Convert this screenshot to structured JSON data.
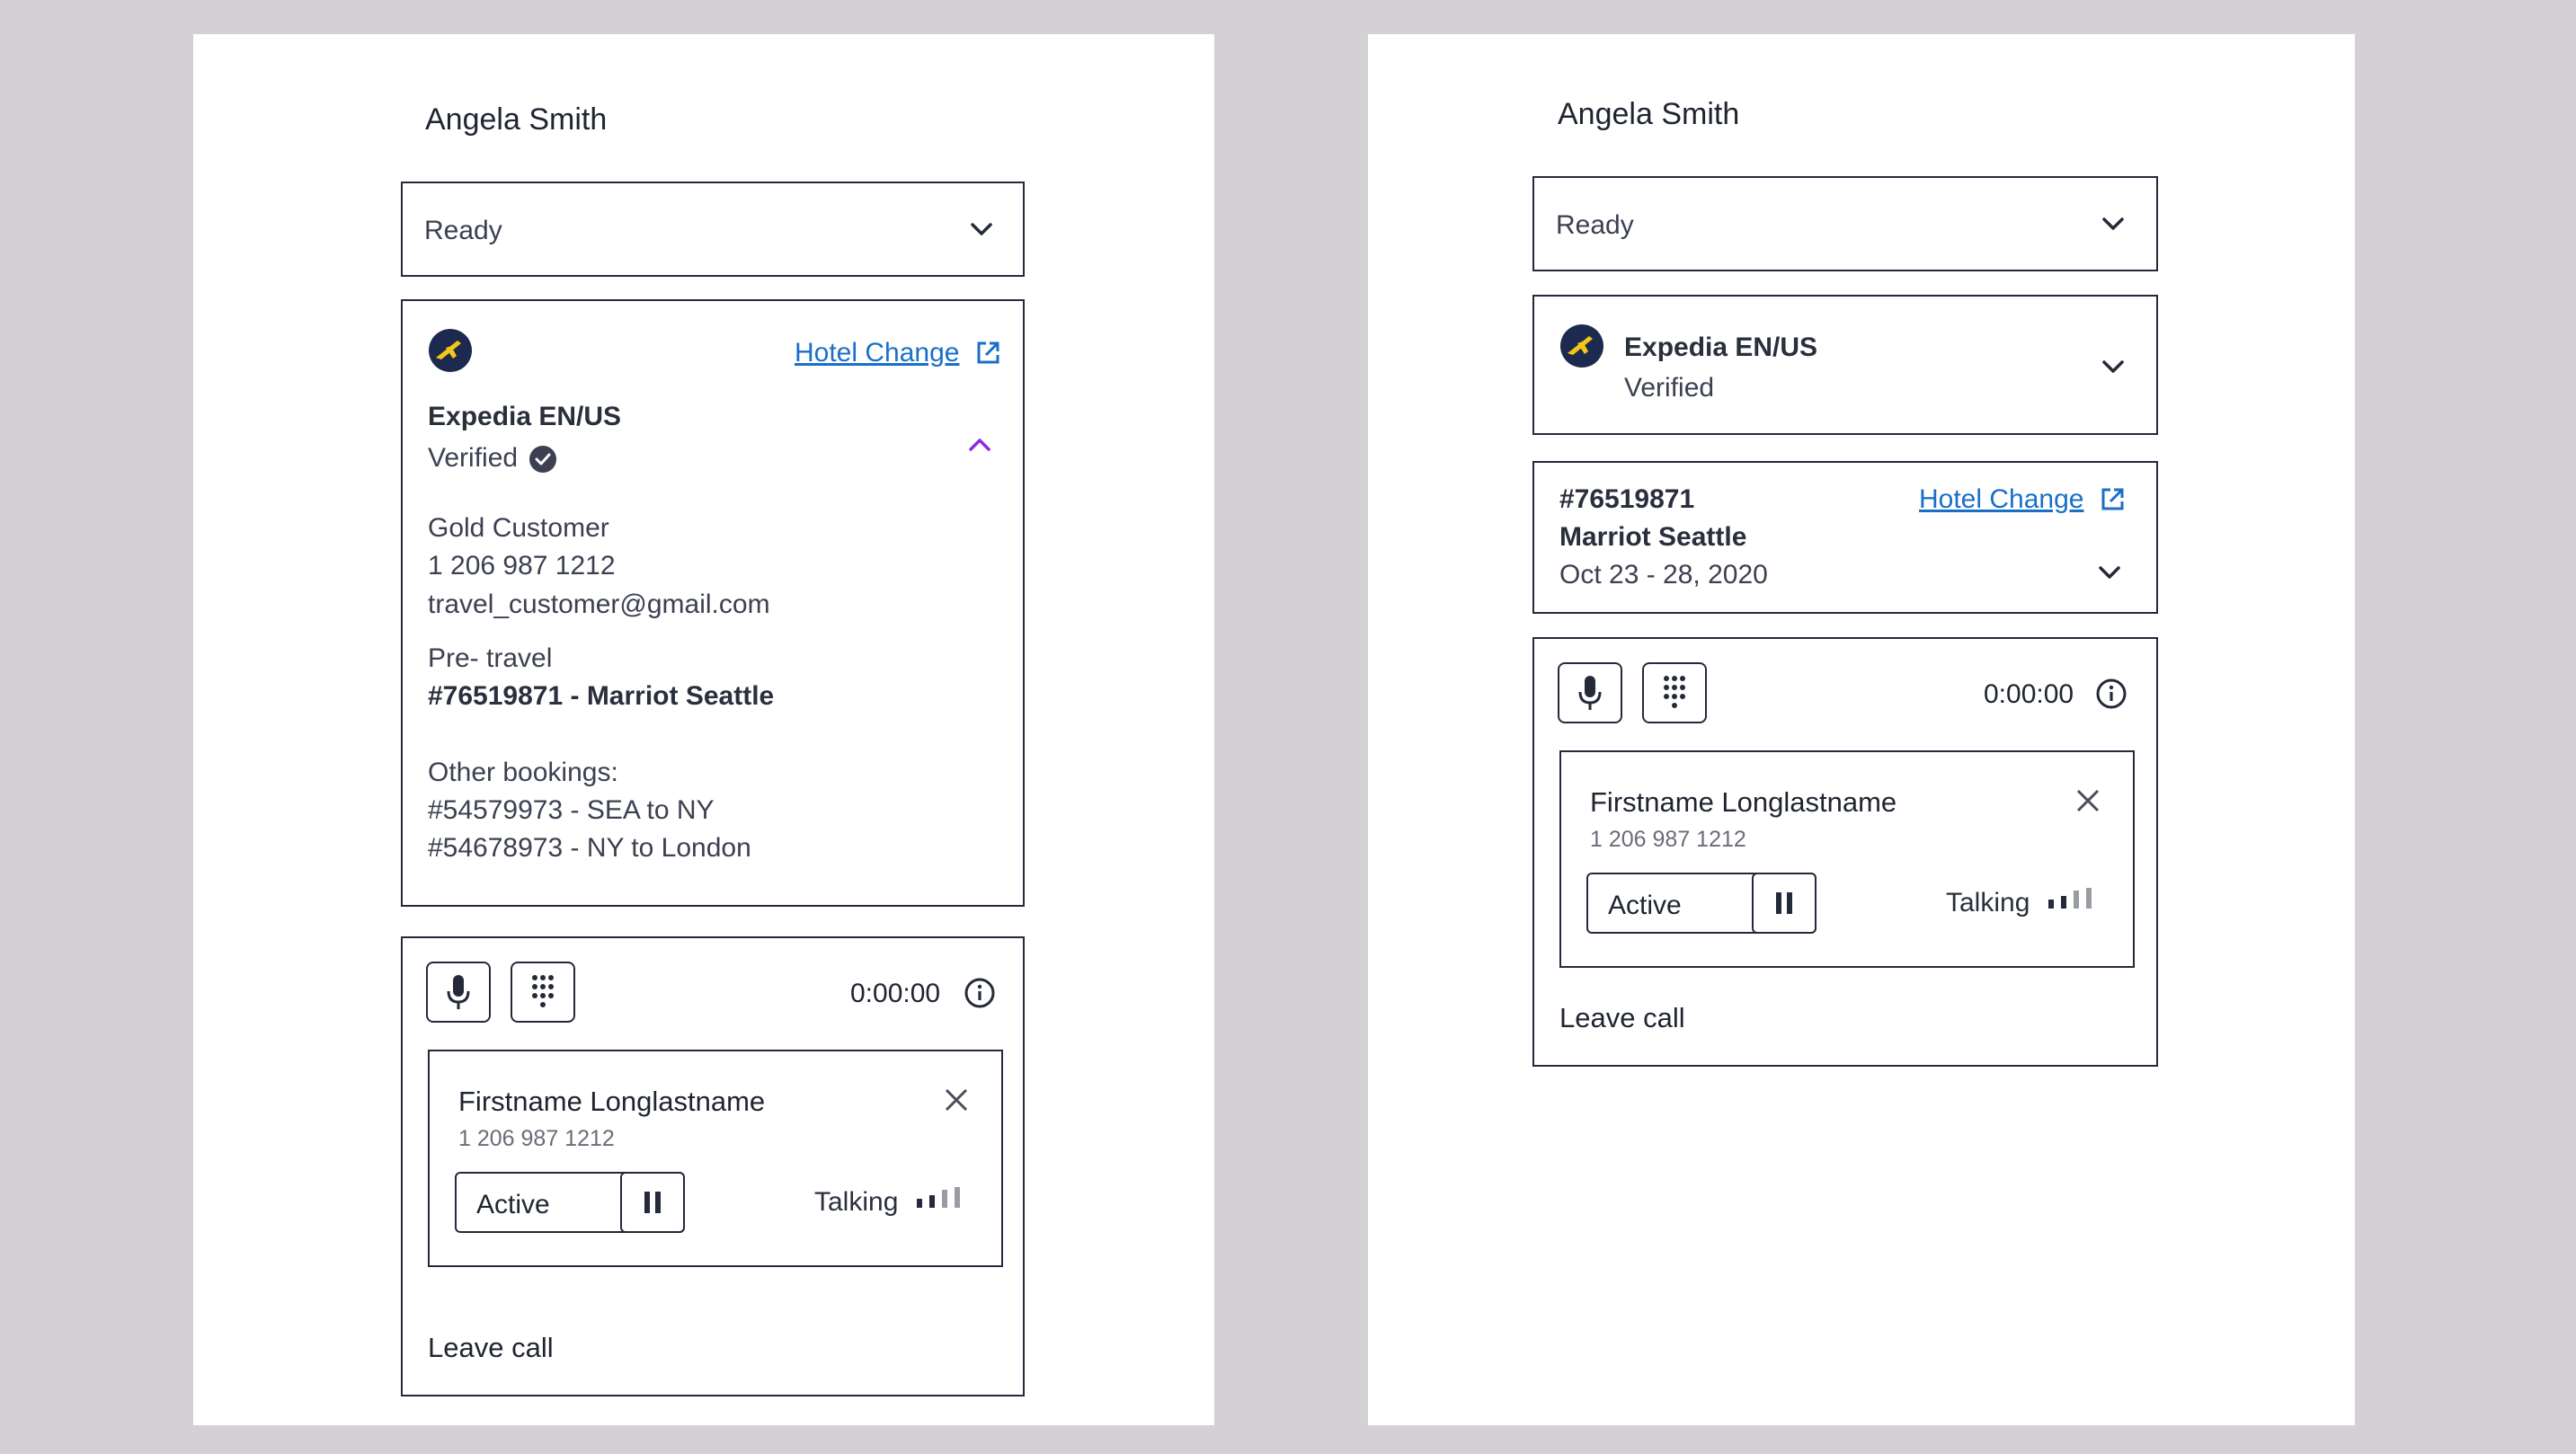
{
  "left": {
    "agent_name": "Angela Smith",
    "status_select": {
      "value": "Ready"
    },
    "customer_card": {
      "brand": "Expedia EN/US",
      "verified": "Verified",
      "link": "Hotel Change",
      "tier": "Gold Customer",
      "phone": "1 206 987 1212",
      "email": "travel_customer@gmail.com",
      "stage": "Pre- travel",
      "current_booking": "#76519871 - Marriot Seattle",
      "other_label": "Other bookings:",
      "other_bookings": [
        "#54579973 - SEA to NY",
        "#54678973 - NY to London"
      ]
    },
    "call": {
      "timer": "0:00:00",
      "participant_name": "Firstname Longlastname",
      "participant_phone": "1 206 987 1212",
      "status": "Active",
      "talking": "Talking",
      "leave": "Leave call"
    }
  },
  "right": {
    "agent_name": "Angela Smith",
    "status_select": {
      "value": "Ready"
    },
    "customer_card": {
      "brand": "Expedia EN/US",
      "verified": "Verified"
    },
    "booking_card": {
      "number": "#76519871",
      "hotel": "Marriot Seattle",
      "dates": "Oct 23 - 28, 2020",
      "link": "Hotel Change"
    },
    "call": {
      "timer": "0:00:00",
      "participant_name": "Firstname Longlastname",
      "participant_phone": "1 206 987 1212",
      "status": "Active",
      "talking": "Talking",
      "leave": "Leave call"
    }
  },
  "colors": {
    "accent_link": "#1a6fc8",
    "expand_chevron": "#8b2be2",
    "border": "#252a3a",
    "logo_bg": "#1d2a4f",
    "logo_plane": "#f5c518"
  }
}
